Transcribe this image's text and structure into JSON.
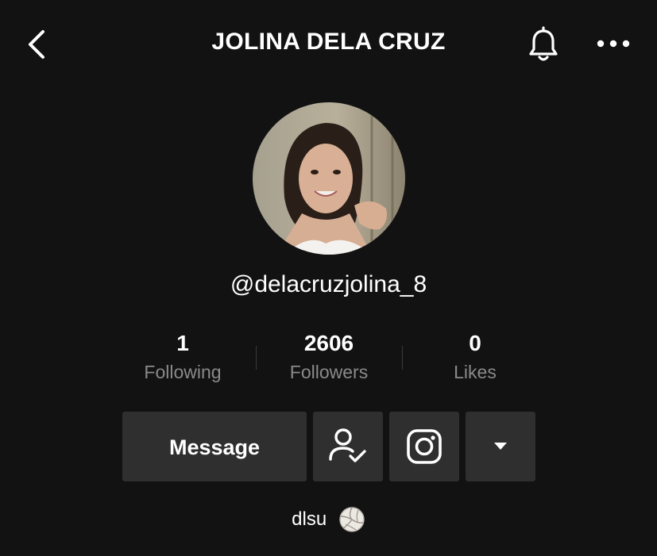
{
  "header": {
    "title": "JOLINA DELA CRUZ",
    "back_icon": "chevron-left-icon",
    "bell_icon": "bell-icon",
    "more_icon": "more-horizontal-icon"
  },
  "profile": {
    "handle": "@delacruzjolina_8",
    "avatar": "profile-photo"
  },
  "stats": [
    {
      "value": "1",
      "label": "Following"
    },
    {
      "value": "2606",
      "label": "Followers"
    },
    {
      "value": "0",
      "label": "Likes"
    }
  ],
  "actions": {
    "message_label": "Message",
    "follow_icon": "user-check-icon",
    "instagram_icon": "instagram-icon",
    "more_icon": "caret-down-icon"
  },
  "bio": {
    "text": "dlsu",
    "emoji": "volleyball-icon"
  },
  "colors": {
    "background": "#121212",
    "button_bg": "#2f2f2f",
    "muted_text": "#8a8a8a",
    "text": "#ffffff"
  }
}
